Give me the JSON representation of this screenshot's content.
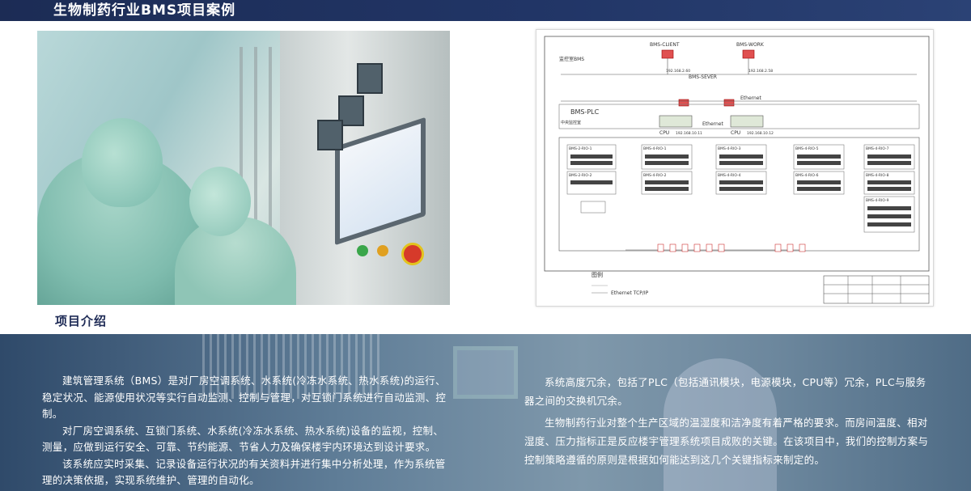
{
  "header": {
    "title": "生物制药行业BMS项目案例"
  },
  "section": {
    "title": "项目介绍"
  },
  "diagram": {
    "client_label": "BMS-CLIENT",
    "work_label": "BMS-WORK",
    "room_label": "监控室BMS",
    "server_label": "BMS-SEVER",
    "plc_label": "BMS-PLC",
    "control_room_label": "中央监控室",
    "ethernet_label_1": "Ethernet",
    "ethernet_label_2": "Ethernet",
    "cpu_label_1": "CPU",
    "cpu_label_2": "CPU",
    "ip_client": "192.168.2.60",
    "ip_work": "192.168.2.58",
    "ip_plc_1": "192.168.10.11",
    "ip_plc_2": "192.168.10.12",
    "rio_labels": [
      "BMS-2-RIO-1",
      "BMS-4-RIO-1",
      "BMS-4-RIO-3",
      "BMS-4-RIO-5",
      "BMS-4-RIO-7",
      "BMS-2-RIO-2",
      "BMS-4-RIO-2",
      "BMS-4-RIO-4",
      "BMS-4-RIO-6",
      "BMS-4-RIO-8",
      "BMS-4-RIO-9"
    ],
    "legend_title": "图例",
    "legend_ethernet": "Ethernet TCP/IP"
  },
  "intro": {
    "left_paragraphs": [
      "建筑管理系统（BMS）是对厂房空调系统、水系统(冷冻水系统、热水系统)的运行、稳定状况、能源使用状况等实行自动监测、控制与管理，对互锁门系统进行自动监测、控制。",
      "对厂房空调系统、互锁门系统、水系统(冷冻水系统、热水系统)设备的监视，控制、测量，应做到运行安全、可靠、节约能源、节省人力及确保楼宇内环境达到设计要求。",
      "该系统应实时采集、记录设备运行状况的有关资料并进行集中分析处理，作为系统管理的决策依据，实现系统维护、管理的自动化。"
    ],
    "right_paragraphs": [
      "系统高度冗余，包括了PLC（包括通讯模块，电源模块，CPU等）冗余，PLC与服务器之间的交换机冗余。",
      "生物制药行业对整个生产区域的温湿度和洁净度有着严格的要求。而房间温度、相对湿度、压力指标正是反应楼宇管理系统项目成败的关键。在该项目中，我们的控制方案与控制策略遵循的原则是根据如何能达到这几个关键指标来制定的。"
    ]
  }
}
